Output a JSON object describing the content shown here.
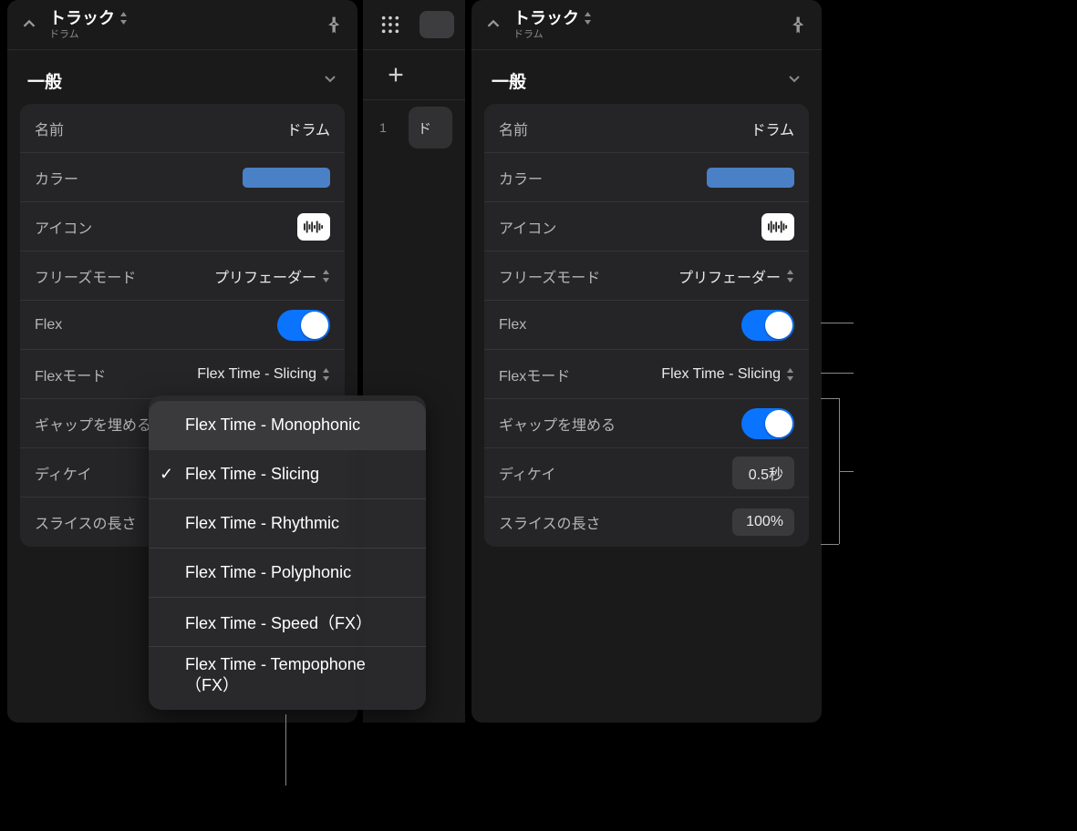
{
  "header": {
    "title": "トラック",
    "subtitle": "ドラム"
  },
  "section": {
    "title": "一般"
  },
  "rows": {
    "name_label": "名前",
    "name_value": "ドラム",
    "color_label": "カラー",
    "color_hex": "#4a80c6",
    "icon_label": "アイコン",
    "freeze_label": "フリーズモード",
    "freeze_value": "プリフェーダー",
    "flex_label": "Flex",
    "flexmode_label": "Flexモード",
    "flexmode_value": "Flex Time - Slicing",
    "gap_label": "ギャップを埋める",
    "decay_label": "ディケイ",
    "decay_value": "0.5秒",
    "slice_label": "スライスの長さ",
    "slice_value": "100%"
  },
  "middle": {
    "track_index": "1",
    "track_initial": "ド"
  },
  "menu": {
    "items": [
      {
        "label": "Flex Time - Monophonic",
        "selected": false
      },
      {
        "label": "Flex Time - Slicing",
        "selected": true
      },
      {
        "label": "Flex Time - Rhythmic",
        "selected": false
      },
      {
        "label": "Flex Time - Polyphonic",
        "selected": false
      },
      {
        "label": "Flex Time - Speed（FX）",
        "selected": false
      },
      {
        "label": "Flex Time - Tempophone（FX）",
        "selected": false
      }
    ]
  }
}
